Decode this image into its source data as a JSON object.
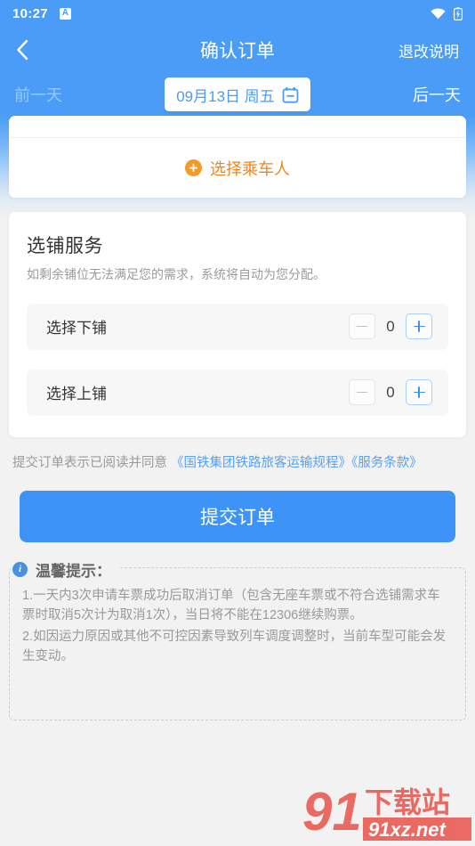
{
  "status_bar": {
    "time": "10:27",
    "app_badge": "A",
    "icons": [
      "wifi-icon",
      "battery-charging-icon"
    ]
  },
  "nav": {
    "back_icon": "chevron-left-icon",
    "title": "确认订单",
    "right_action": "退改说明"
  },
  "date_switcher": {
    "prev_label": "前一天",
    "current_date": "09月13日 周五",
    "calendar_icon": "calendar-icon",
    "next_label": "后一天"
  },
  "passenger_card": {
    "add_icon": "plus-circle-icon",
    "add_label": "选择乘车人",
    "accent_color": "#f08519"
  },
  "berth_service": {
    "title": "选铺服务",
    "subtitle": "如剩余铺位无法满足您的需求，系统将自动为您分配。",
    "rows": [
      {
        "label": "选择下铺",
        "value": "0",
        "minus_enabled": false,
        "plus_enabled": true
      },
      {
        "label": "选择上铺",
        "value": "0",
        "minus_enabled": false,
        "plus_enabled": true
      }
    ]
  },
  "agreement": {
    "prefix": "提交订单表示已阅读并同意 ",
    "link1": "《国铁集团铁路旅客运输规程》",
    "link2": "《服务条款》",
    "link_color": "#57a1f3"
  },
  "submit": {
    "label": "提交订单",
    "color": "#3d94f6"
  },
  "tips": {
    "icon": "info-icon",
    "label": "温馨提示：",
    "items": [
      "1.一天内3次申请车票成功后取消订单（包含无座车票或不符合选铺需求车票时取消5次计为取消1次），当日将不能在12306继续购票。",
      "2.如因运力原因或其他不可控因素导致列车调度调整时，当前车型可能会发生变动。"
    ]
  },
  "watermark": {
    "logo_text": "91",
    "brand_text": "下载站",
    "url_text": "91xz.net",
    "color": "#e8453c"
  },
  "theme": {
    "header_blue": "#4a9cf6",
    "page_background": "#f2f2f2",
    "card_background": "#ffffff",
    "row_background": "#f7f7f8"
  }
}
